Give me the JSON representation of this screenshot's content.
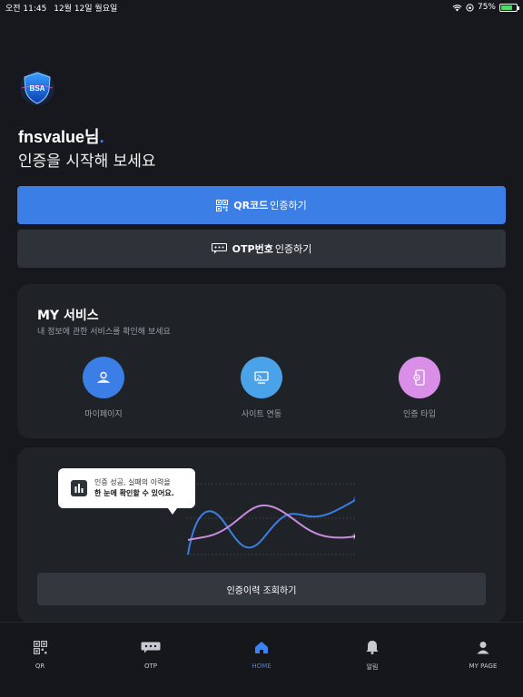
{
  "status": {
    "time": "오전 11:45",
    "date": "12월 12일 월요일",
    "battery": "75%",
    "battery_level": 0.75
  },
  "logo": {
    "text": "BSA"
  },
  "greeting": {
    "name": "fnsvalue님",
    "dot": ".",
    "subtitle": "인증을 시작해 보세요"
  },
  "auth_buttons": {
    "qr_bold": "QR코드",
    "qr_rest": "인증하기",
    "otp_bold": "OTP번호",
    "otp_rest": "인증하기"
  },
  "my_service": {
    "title": "MY 서비스",
    "description": "내 정보에 관한 서비스를 확인해 보세요",
    "items": [
      {
        "label": "마이페이지",
        "icon": "person-icon",
        "color": "#3b7ee6"
      },
      {
        "label": "사이트 연동",
        "icon": "cast-icon",
        "color": "#4aa3e8"
      },
      {
        "label": "인증 타입",
        "icon": "phone-gear-icon",
        "color": "#d98fe8"
      }
    ]
  },
  "history": {
    "tooltip_line1": "인증 성공, 실패의 이력을",
    "tooltip_line2_bold": "한 눈에 확인할",
    "tooltip_line2_rest": " 수 있어요.",
    "button": "인증이력 조회하기"
  },
  "colors": {
    "accent": "#3b7ee6",
    "background": "#16181d",
    "card": "#1f2227",
    "line_blue": "#3b7ee6",
    "line_purple": "#c98de0"
  },
  "tabbar": [
    {
      "label": "QR",
      "icon": "qr-icon",
      "active": false
    },
    {
      "label": "OTP",
      "icon": "otp-icon",
      "active": false
    },
    {
      "label": "HOME",
      "icon": "home-icon",
      "active": true
    },
    {
      "label": "알림",
      "icon": "bell-icon",
      "active": false
    },
    {
      "label": "MY PAGE",
      "icon": "user-icon",
      "active": false
    }
  ]
}
